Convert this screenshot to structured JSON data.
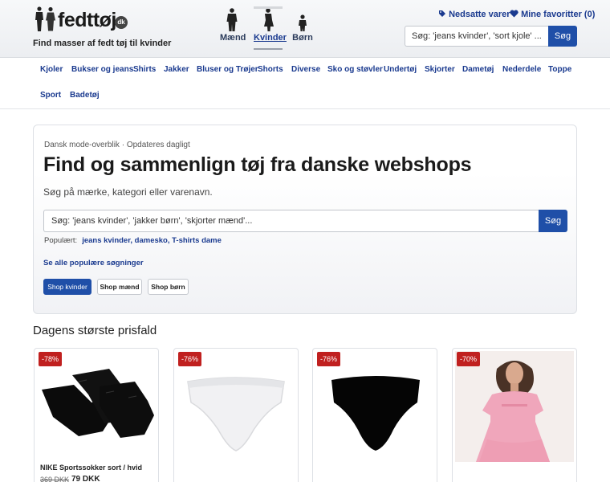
{
  "header": {
    "logo_text": "fedttøj",
    "logo_tld": "dk",
    "tagline": "Find masser af fedt tøj til kvinder",
    "genders": [
      {
        "label": "Mænd",
        "icon": "man-silhouette-icon"
      },
      {
        "label": "Kvinder",
        "icon": "woman-silhouette-icon",
        "active": true
      },
      {
        "label": "Børn",
        "icon": "child-silhouette-icon"
      }
    ],
    "sale_link": "Nedsatte varer",
    "favorites_link": "Mine favoritter (0)",
    "search_placeholder": "Søg: 'jeans kvinder', 'sort kjole' ...",
    "search_button": "Søg"
  },
  "nav": {
    "categories": [
      "Kjoler",
      "Bukser og jeans",
      "Shirts",
      "Jakker",
      "Bluser og Trøjer",
      "Shorts",
      "Diverse",
      "Sko og støvler",
      "Undertøj",
      "Skjorter",
      "Dametøj",
      "Nederdele",
      "Toppe",
      "Sport",
      "Badetøj"
    ]
  },
  "hero": {
    "crumb": "Dansk mode-overblik · Opdateres dagligt",
    "title": "Find og sammenlign tøj fra danske webshops",
    "subtitle": "Søg på mærke, kategori eller varenavn.",
    "search_placeholder": "Søg: 'jeans kvinder', 'jakker børn', 'skjorter mænd'...",
    "search_button": "Søg",
    "popular_label": "Populært:",
    "popular_links": "jeans kvinder, damesko, T-shirts dame",
    "all_searches": "Se alle populære søgninger",
    "shop_buttons": [
      "Shop kvinder",
      "Shop mænd",
      "Shop børn"
    ]
  },
  "deals": {
    "title": "Dagens største prisfald",
    "products": [
      {
        "badge": "-78%",
        "name": "NIKE Sportssokker sort / hvid",
        "old_price": "369 DKK",
        "price": "79 DKK"
      },
      {
        "badge": "-76%",
        "name": "",
        "old_price": "",
        "price": ""
      },
      {
        "badge": "-76%",
        "name": "",
        "old_price": "",
        "price": ""
      },
      {
        "badge": "-70%",
        "name": "",
        "old_price": "",
        "price": ""
      }
    ]
  },
  "colors": {
    "brand_blue": "#1f4fa8",
    "link_blue": "#1a3a8f",
    "badge_red": "#c0201f"
  }
}
